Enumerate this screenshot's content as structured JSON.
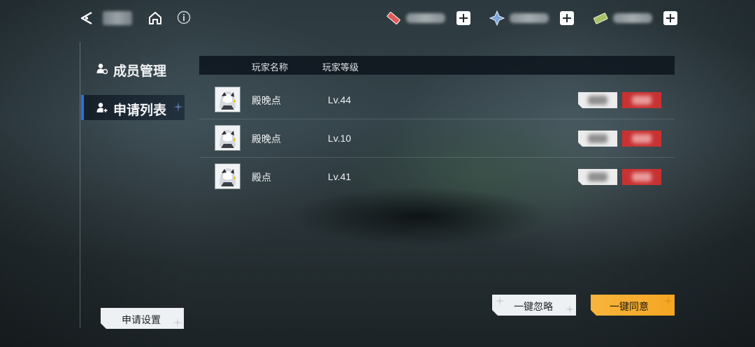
{
  "side_menu": {
    "items": [
      {
        "label": "成员管理",
        "icon": "member-manage-icon"
      },
      {
        "label": "申请列表",
        "icon": "apply-list-icon",
        "active": true
      }
    ]
  },
  "table": {
    "headers": {
      "name": "玩家名称",
      "level": "玩家等级"
    },
    "rows": [
      {
        "name": "殿晚点",
        "level": "Lv.44"
      },
      {
        "name": "殿晚点",
        "level": "Lv.10"
      },
      {
        "name": "殿点",
        "level": "Lv.41"
      }
    ]
  },
  "buttons": {
    "settings": "申请设置",
    "ignore_all": "一键忽略",
    "accept_all": "一键同意"
  },
  "colors": {
    "accent_blue": "#2f6fe0",
    "accept_red": "#c83232",
    "accept_all_orange": "#f5a623"
  }
}
